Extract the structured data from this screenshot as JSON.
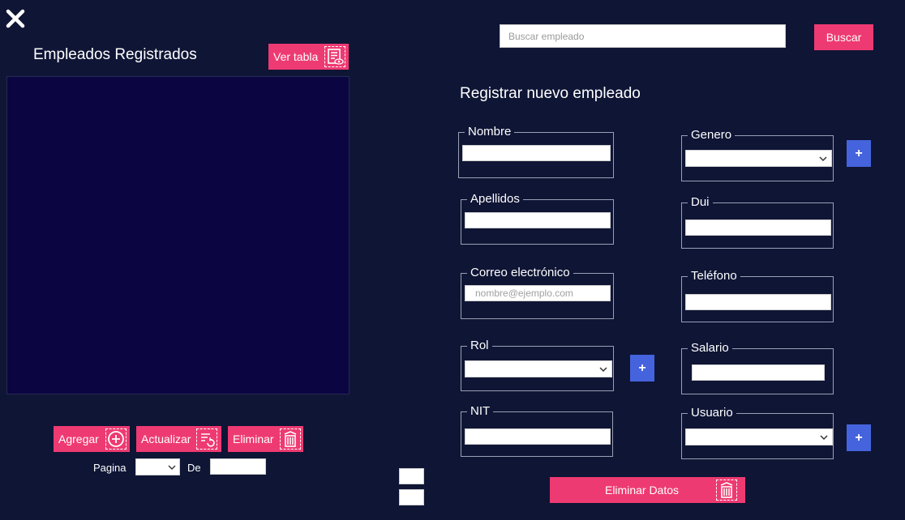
{
  "window": {
    "close_icon": "close-icon"
  },
  "list_section": {
    "title": "Empleados Registrados",
    "view_table_label": "Ver tabla",
    "add_label": "Agregar",
    "update_label": "Actualizar",
    "delete_label": "Eliminar",
    "page_label": "Pagina",
    "of_label": "De"
  },
  "search": {
    "placeholder": "Buscar empleado",
    "button_label": "Buscar"
  },
  "form": {
    "title": "Registrar nuevo empleado",
    "fields": {
      "nombre": {
        "label": "Nombre"
      },
      "apellidos": {
        "label": "Apellidos"
      },
      "correo": {
        "label": "Correo electrónico",
        "placeholder": "nombre@ejemplo.com"
      },
      "rol": {
        "label": "Rol"
      },
      "nit": {
        "label": "NIT"
      },
      "genero": {
        "label": "Genero"
      },
      "dui": {
        "label": "Dui"
      },
      "telefono": {
        "label": "Teléfono"
      },
      "salario": {
        "label": "Salario"
      },
      "usuario": {
        "label": "Usuario"
      }
    },
    "plus_label": "+",
    "clear_label": "Eliminar Datos"
  },
  "colors": {
    "background": "#0f1535",
    "panel": "#0b0542",
    "accent_pink": "#ee3a72",
    "accent_blue": "#4563dd"
  }
}
